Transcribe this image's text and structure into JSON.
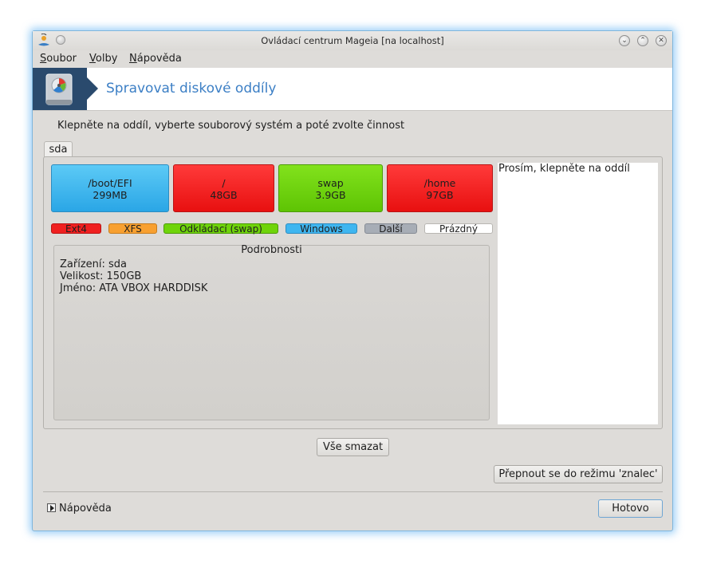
{
  "window": {
    "title": "Ovládací centrum Mageia  [na localhost]",
    "controls": {
      "minimize": "⌄",
      "maximize": "⌃",
      "close": "✕"
    }
  },
  "menu": {
    "items": [
      {
        "label": "Soubor"
      },
      {
        "label": "Volby"
      },
      {
        "label": "Nápověda"
      }
    ]
  },
  "banner": {
    "title": "Spravovat diskové oddíly",
    "icon": "harddisk-icon"
  },
  "instruction": "Klepněte na oddíl, vyberte souborový systém a poté zvolte činnost",
  "tabs": [
    {
      "label": "sda"
    }
  ],
  "partitions": [
    {
      "name": "/boot/EFI",
      "size": "299MB",
      "color": "#3fb6f0"
    },
    {
      "name": "/",
      "size": "48GB",
      "color": "#f02020"
    },
    {
      "name": "swap",
      "size": "3.9GB",
      "color": "#6fd40a"
    },
    {
      "name": "/home",
      "size": "97GB",
      "color": "#f02020"
    }
  ],
  "legend": [
    {
      "label": "Ext4",
      "color": "#f02020"
    },
    {
      "label": "XFS",
      "color": "#f8a030"
    },
    {
      "label": "Odkládací (swap)",
      "color": "#6fd40a"
    },
    {
      "label": "Windows",
      "color": "#3fb6f0"
    },
    {
      "label": "Další",
      "color": "#a7adb6"
    },
    {
      "label": "Prázdný",
      "color": "#ffffff"
    }
  ],
  "details": {
    "title": "Podrobnosti",
    "lines": [
      "Zařízení: sda",
      "Velikost: 150GB",
      "Jméno: ATA VBOX HARDDISK"
    ]
  },
  "info_pane": {
    "text": "Prosím, klepněte na oddíl"
  },
  "buttons": {
    "clear_all": "Vše smazat",
    "expert_mode": "Přepnout se do režimu 'znalec'",
    "done": "Hotovo"
  },
  "help": {
    "label": "Nápověda"
  }
}
